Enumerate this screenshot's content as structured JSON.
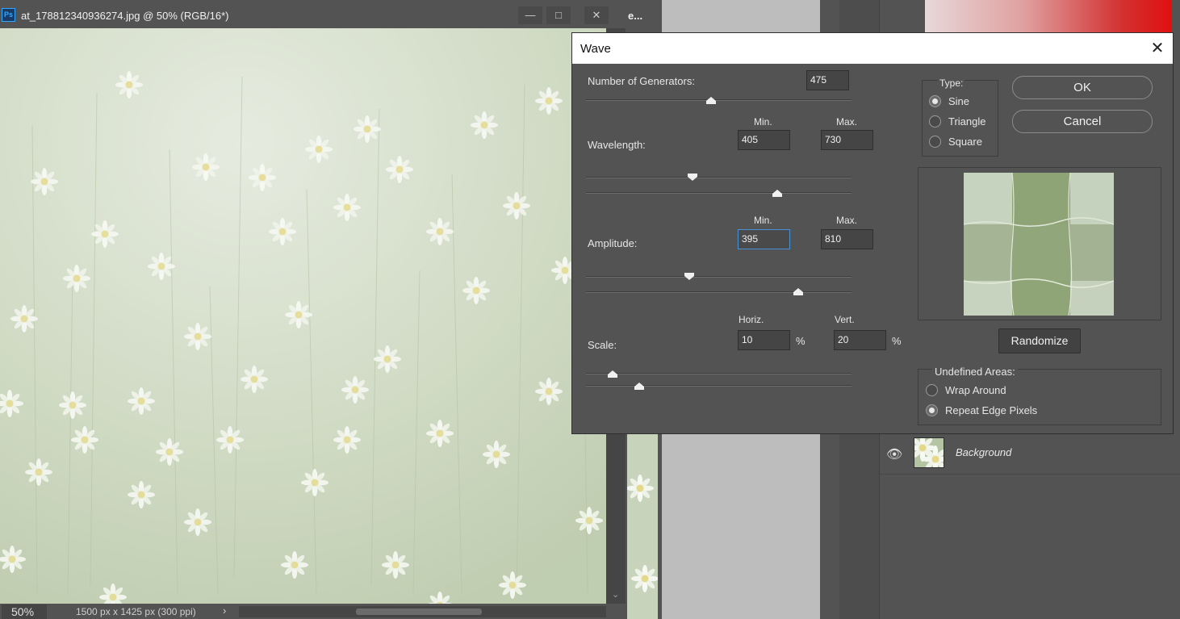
{
  "document": {
    "title": "at_178812340936274.jpg @ 50% (RGB/16*)",
    "app_icon": "Ps",
    "controls": {
      "minimize": "—",
      "maximize": "□",
      "close": "✕"
    },
    "status": {
      "zoom": "50%",
      "info": "1500 px x 1425 px (300 ppi)",
      "arrow": "›"
    }
  },
  "background": {
    "tab_peek": "e...",
    "layers": [
      {
        "name": "Background",
        "visible_icon": "eye-icon"
      }
    ]
  },
  "dialog": {
    "title": "Wave",
    "close": "✕",
    "generators": {
      "label": "Number of Generators:",
      "value": "475",
      "slider": 0.47
    },
    "wavelength": {
      "label": "Wavelength:",
      "min_label": "Min.",
      "max_label": "Max.",
      "min": "405",
      "max": "730",
      "slider_min": 0.4,
      "slider_max": 0.72
    },
    "amplitude": {
      "label": "Amplitude:",
      "min_label": "Min.",
      "max_label": "Max.",
      "min": "395",
      "max": "810",
      "slider_min": 0.39,
      "slider_max": 0.8
    },
    "scale": {
      "label": "Scale:",
      "horiz_label": "Horiz.",
      "vert_label": "Vert.",
      "horiz": "10",
      "vert": "20",
      "unit": "%",
      "slider_h": 0.1,
      "slider_v": 0.2
    },
    "type": {
      "label": "Type:",
      "options": [
        "Sine",
        "Triangle",
        "Square"
      ],
      "selected": "Sine"
    },
    "buttons": {
      "ok": "OK",
      "cancel": "Cancel",
      "randomize": "Randomize"
    },
    "undefined_areas": {
      "label": "Undefined Areas:",
      "options": [
        "Wrap Around",
        "Repeat Edge Pixels"
      ],
      "selected": "Repeat Edge Pixels"
    }
  }
}
